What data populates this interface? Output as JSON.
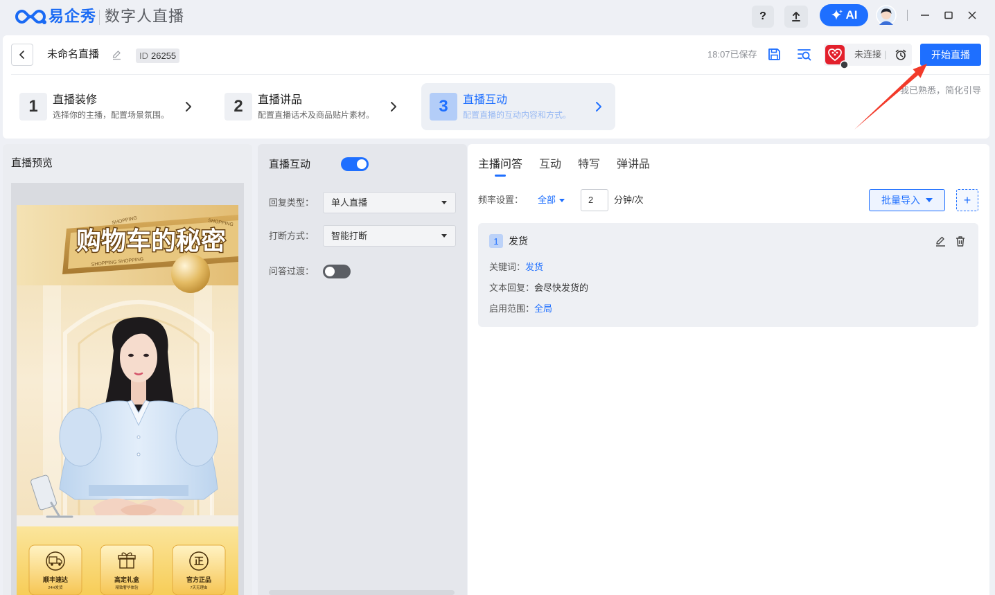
{
  "app": {
    "brand": "易企秀",
    "product": "数字人直播"
  },
  "titlebar": {
    "help_label": "?",
    "ai_label": "AI"
  },
  "header": {
    "title": "未命名直播",
    "id_label": "ID",
    "id_value": "26255",
    "saved_status": "18:07已保存",
    "connection_status": "未连接",
    "connection_separator": "|",
    "start_button": "开始直播"
  },
  "steps": [
    {
      "number": "1",
      "title": "直播装修",
      "subtitle": "选择你的主播，配置场景氛围。",
      "active": false
    },
    {
      "number": "2",
      "title": "直播讲品",
      "subtitle": "配置直播话术及商品贴片素材。",
      "active": false
    },
    {
      "number": "3",
      "title": "直播互动",
      "subtitle": "配置直播的互动内容和方式。",
      "active": true
    }
  ],
  "guide": {
    "simplify_label": "我已熟悉，简化引导"
  },
  "preview": {
    "title": "直播预览",
    "scene": {
      "banner_title": "购物车的秘密",
      "banner_tags": [
        "SHOPPING",
        "SHOPPING",
        "SHOPPING SHOPPING"
      ],
      "badges": [
        {
          "icon": "truck-icon",
          "title": "顺丰速达",
          "caption": "24H发货"
        },
        {
          "icon": "gift-icon",
          "title": "高定礼盒",
          "caption": "精致奢华体验"
        },
        {
          "icon": "genuine-seal-icon",
          "glyph": "正",
          "title": "官方正品",
          "caption": "7天无理由"
        }
      ]
    }
  },
  "interaction": {
    "label": "直播互动",
    "enabled": true,
    "reply_type_label": "回复类型：",
    "reply_type_value": "单人直播",
    "interrupt_label": "打断方式：",
    "interrupt_value": "智能打断",
    "transition_label": "问答过渡：",
    "transition_enabled": false
  },
  "qa": {
    "tabs": [
      "主播问答",
      "互动",
      "特写",
      "弹讲品"
    ],
    "active_tab": 0,
    "frequency_label": "频率设置：",
    "frequency_scope": "全部",
    "frequency_value": "2",
    "frequency_unit": "分钟/次",
    "import_button": "批量导入",
    "add_button": "+",
    "items": [
      {
        "index": "1",
        "name": "发货",
        "keyword_label": "关键词：",
        "keyword": "发货",
        "reply_label": "文本回复：",
        "reply": "会尽快发货的",
        "scope_label": "启用范围：",
        "scope": "全局"
      }
    ]
  },
  "colors": {
    "accent": "#1e6fff",
    "highlight_arrow": "#f23a2a"
  }
}
